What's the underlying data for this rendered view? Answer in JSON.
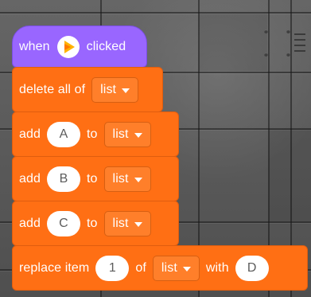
{
  "script": {
    "hat": {
      "when": "when",
      "clicked": "clicked",
      "icon": "green-flag-icon"
    },
    "blocks": [
      {
        "label_before": "delete all of",
        "list": "list"
      },
      {
        "label_before": "add",
        "value": "A",
        "label_mid": "to",
        "list": "list"
      },
      {
        "label_before": "add",
        "value": "B",
        "label_mid": "to",
        "list": "list"
      },
      {
        "label_before": "add",
        "value": "C",
        "label_mid": "to",
        "list": "list"
      },
      {
        "label_before": "replace item",
        "index": "1",
        "label_mid": "of",
        "list": "list",
        "label_after": "with",
        "value": "D"
      }
    ]
  },
  "colors": {
    "events": "#9966ff",
    "lists": "#ff6f14",
    "background": "#5d5d5d"
  }
}
